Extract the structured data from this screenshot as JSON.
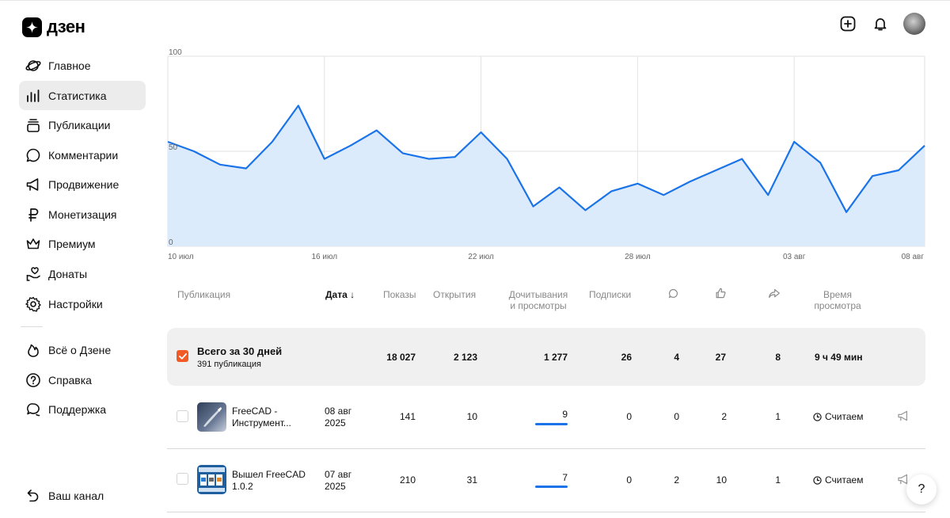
{
  "brand": {
    "name": "дзен"
  },
  "header": {
    "icons": [
      "add-icon",
      "bell-icon",
      "avatar"
    ]
  },
  "sidebar": {
    "items": [
      {
        "label": "Главное",
        "icon": "planet-icon"
      },
      {
        "label": "Статистика",
        "icon": "bar-chart-icon",
        "active": true
      },
      {
        "label": "Публикации",
        "icon": "stack-icon"
      },
      {
        "label": "Комментарии",
        "icon": "comment-icon"
      },
      {
        "label": "Продвижение",
        "icon": "megaphone-icon"
      },
      {
        "label": "Монетизация",
        "icon": "ruble-icon"
      },
      {
        "label": "Премиум",
        "icon": "crown-icon"
      },
      {
        "label": "Донаты",
        "icon": "donate-icon"
      },
      {
        "label": "Настройки",
        "icon": "gear-icon"
      }
    ],
    "secondary": [
      {
        "label": "Всё о Дзене",
        "icon": "flame-icon"
      },
      {
        "label": "Справка",
        "icon": "question-icon"
      },
      {
        "label": "Поддержка",
        "icon": "support-icon"
      }
    ],
    "channel": {
      "label": "Ваш канал",
      "icon": "back-icon"
    }
  },
  "chart_data": {
    "type": "area",
    "color": "#1a73e8",
    "fill": "#dcebfb",
    "ylim": [
      0,
      100
    ],
    "y_ticks": [
      "100",
      "50",
      "0"
    ],
    "x_ticks": [
      "10 июл",
      "16 июл",
      "22 июл",
      "28 июл",
      "03 авг",
      "08 авг"
    ],
    "values": [
      55,
      50,
      43,
      41,
      55,
      74,
      46,
      53,
      61,
      49,
      46,
      47,
      60,
      46,
      21,
      31,
      19,
      29,
      33,
      27,
      34,
      40,
      46,
      27,
      55,
      44,
      18,
      37,
      40,
      53
    ]
  },
  "table": {
    "headers": {
      "publication": "Публикация",
      "date": "Дата",
      "sort_arrow": "↓",
      "shows": "Показы",
      "opens": "Открытия",
      "reads_1": "Дочитывания",
      "reads_2": "и просмотры",
      "subs": "Подписки",
      "time_1": "Время",
      "time_2": "просмотра"
    },
    "total": {
      "title": "Всего за 30 дней",
      "subtitle": "391 публикация",
      "shows": "18 027",
      "opens": "2 123",
      "reads": "1 277",
      "subs": "26",
      "comments": "4",
      "likes": "27",
      "shares": "8",
      "time": "9 ч 49 мин"
    },
    "rows": [
      {
        "title_1": "FreeCAD -",
        "title_2": "Инструмент...",
        "date_1": "08 авг",
        "date_2": "2025",
        "shows": "141",
        "opens": "10",
        "reads": "9",
        "reads_fraction": 1.0,
        "subs": "0",
        "comments": "0",
        "likes": "2",
        "shares": "1",
        "time": "Считаем"
      },
      {
        "title_1": "Вышел FreeCAD",
        "title_2": "1.0.2",
        "date_1": "07 авг",
        "date_2": "2025",
        "shows": "210",
        "opens": "31",
        "reads": "7",
        "reads_fraction": 1.0,
        "subs": "0",
        "comments": "2",
        "likes": "10",
        "shares": "1",
        "time": "Считаем"
      }
    ]
  },
  "help": {
    "label": "?"
  }
}
